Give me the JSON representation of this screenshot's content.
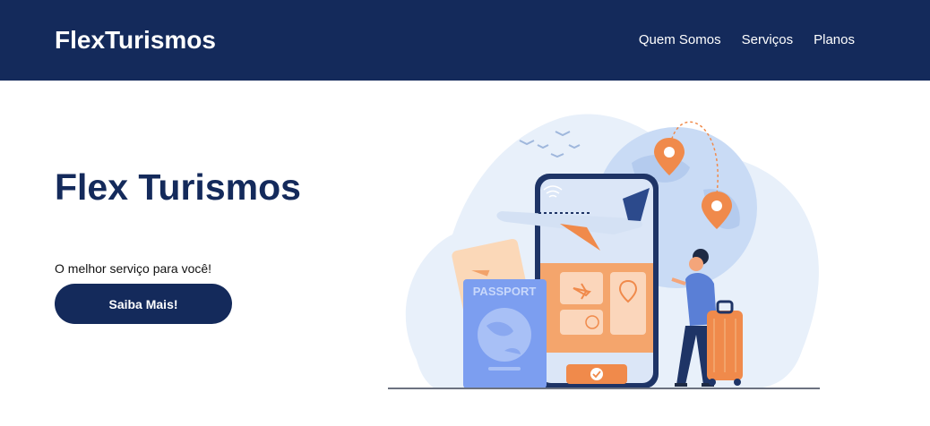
{
  "header": {
    "brand": "FlexTurismos",
    "nav": [
      "Quem Somos",
      "Serviços",
      "Planos"
    ]
  },
  "hero": {
    "title": "Flex Turismos",
    "subtitle": "O melhor serviço para você!",
    "cta_label": "Saiba Mais!"
  },
  "illustration": {
    "passport_label": "PASSPORT",
    "icons": [
      "wifi-icon",
      "airplane-icon",
      "location-pin-icon",
      "clock-icon",
      "check-icon",
      "globe-icon",
      "suitcase-icon"
    ]
  },
  "colors": {
    "primary": "#142a5b",
    "accent": "#f08a4b",
    "light": "#dde9f8",
    "blue": "#7c9ef0"
  }
}
